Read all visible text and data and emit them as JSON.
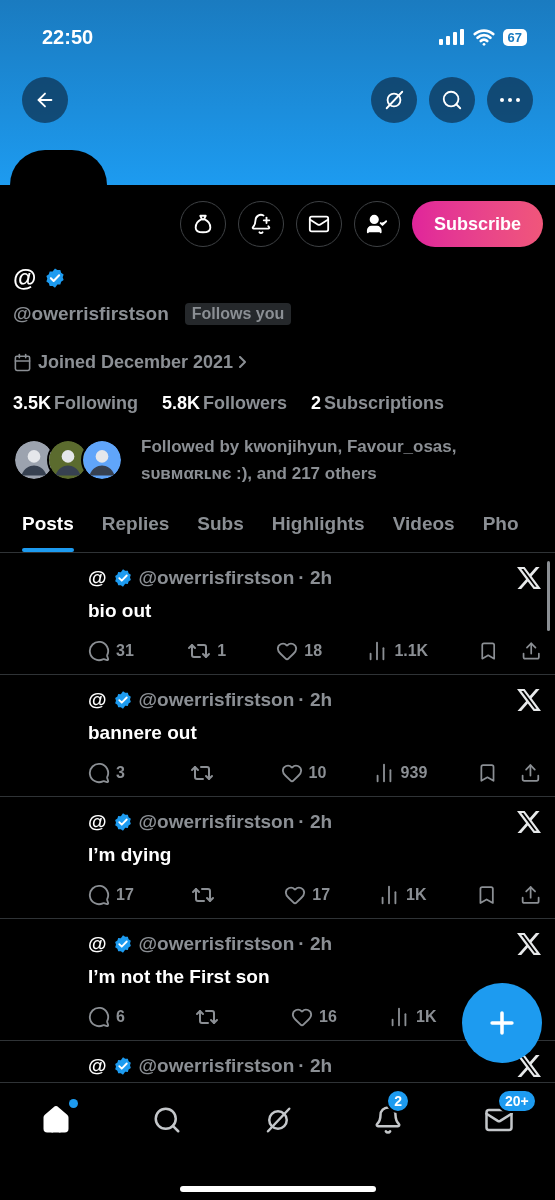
{
  "status_bar": {
    "time": "22:50",
    "battery": "67"
  },
  "profile": {
    "name": "@",
    "verified": true,
    "handle": "@owerrisfirstson",
    "follows_you": "Follows you",
    "joined": "Joined December 2021",
    "subscribe": "Subscribe",
    "stats": [
      {
        "number": "3.5K",
        "caption": "Following"
      },
      {
        "number": "5.8K",
        "caption": "Followers"
      },
      {
        "number": "2",
        "caption": "Subscriptions"
      }
    ],
    "followed_by": "Followed by kwonjihyun, Favour_osas, sᴜʙᴍαʀʟɴє :), and 217 others",
    "follower_avatars": [
      {
        "color": "#9ca3af"
      },
      {
        "color": "#5b6b2e"
      },
      {
        "color": "#60a5fa"
      }
    ]
  },
  "tabs": [
    {
      "label": "Posts",
      "selected": true
    },
    {
      "label": "Replies",
      "selected": false
    },
    {
      "label": "Subs",
      "selected": false
    },
    {
      "label": "Highlights",
      "selected": false
    },
    {
      "label": "Videos",
      "selected": false
    },
    {
      "label": "Pho",
      "selected": false
    }
  ],
  "posts": [
    {
      "name": "@",
      "handle": "@owerrisfirstson",
      "time": "· 2h",
      "text": "bio out",
      "replies": "31",
      "reposts": "1",
      "likes": "18",
      "views": "1.1K",
      "tools": true
    },
    {
      "name": "@",
      "handle": "@owerrisfirstson",
      "time": "· 2h",
      "text": "bannere out",
      "replies": "3",
      "likes": "10",
      "views": "939",
      "tools": true
    },
    {
      "name": "@",
      "handle": "@owerrisfirstson",
      "time": "· 2h",
      "text": "I’m dying",
      "replies": "17",
      "likes": "17",
      "views": "1K",
      "tools": true
    },
    {
      "name": "@",
      "handle": "@owerrisfirstson",
      "time": "· 2h",
      "text": "I’m not the First son",
      "replies": "6",
      "likes": "16",
      "views": "1K",
      "tools": false
    },
    {
      "name": "@",
      "handle": "@owerrisfirstson",
      "time": "· 2h"
    }
  ],
  "nav": [
    {
      "kind": "home",
      "selected": true,
      "dot": true
    },
    {
      "kind": "search",
      "selected": false
    },
    {
      "kind": "grok",
      "selected": false
    },
    {
      "kind": "notifications",
      "selected": false,
      "badge": "2"
    },
    {
      "kind": "messages",
      "selected": false,
      "badge": "20+"
    }
  ]
}
